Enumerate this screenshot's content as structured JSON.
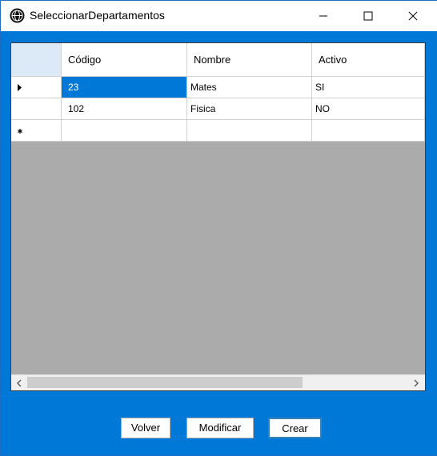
{
  "window": {
    "title": "SeleccionarDepartamentos",
    "icon": "app-globe-icon",
    "controls": [
      "minimize-icon",
      "maximize-icon",
      "close-icon"
    ]
  },
  "grid": {
    "columns": [
      "Código",
      "Nombre",
      "Activo"
    ],
    "rows": [
      {
        "indicator": "current-row-arrow-icon",
        "cells": [
          "23",
          "Mates",
          "SI"
        ]
      },
      {
        "indicator": "",
        "cells": [
          "102",
          "Fisica",
          "NO"
        ]
      },
      {
        "indicator": "new-row-asterisk-icon",
        "cells": [
          "",
          "",
          ""
        ]
      }
    ],
    "selected_cell": {
      "row": 0,
      "column": "Código"
    }
  },
  "buttons": {
    "volver": "Volver",
    "modificar": "Modificar",
    "crear": "Crear"
  },
  "colors": {
    "form_background": "#0078d7",
    "grid_background": "#ababab",
    "selection": "#0078d7",
    "header_corner": "#dce9f7"
  }
}
